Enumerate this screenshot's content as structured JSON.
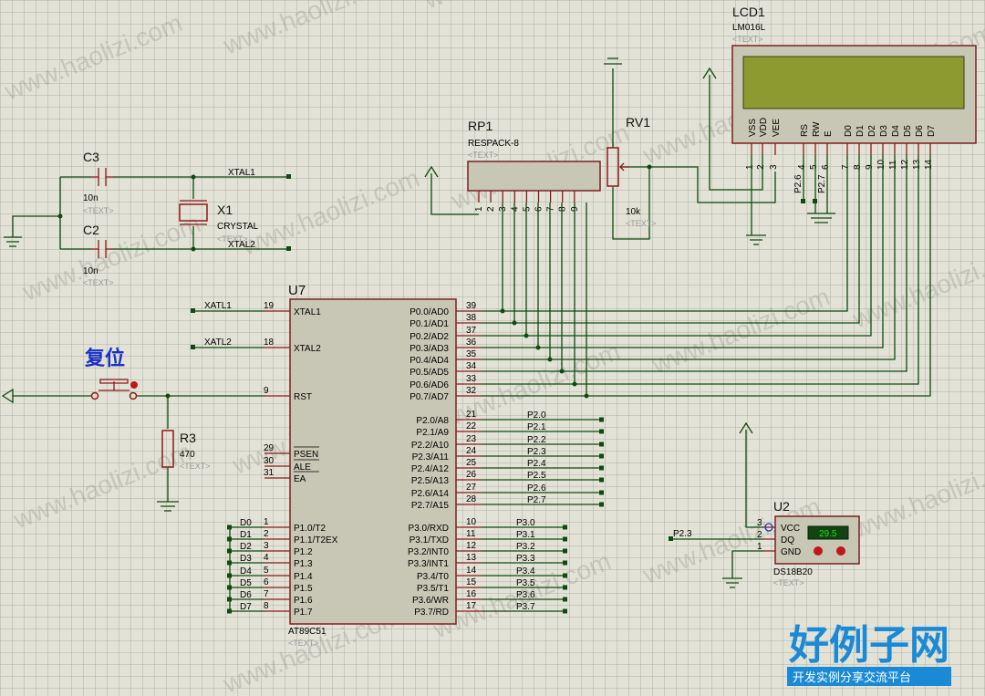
{
  "labels": {
    "c3": "C3",
    "c3_val": "10n",
    "c2": "C2",
    "c2_val": "10n",
    "x1": "X1",
    "x1_val": "CRYSTAL",
    "xtal1": "XTAL1",
    "xtal2": "XTAL2",
    "atxl1": "XATL1",
    "atxl2": "XATL2",
    "rp1": "RP1",
    "rp1_val": "RESPACK-8",
    "rv1": "RV1",
    "rv1_val": "10k",
    "lcd1": "LCD1",
    "lcd1_val": "LM016L",
    "u7": "U7",
    "u7_val": "AT89C51",
    "r3": "R3",
    "r3_val": "470",
    "reset": "复位",
    "u2": "U2",
    "u2_val": "DS18B20",
    "temp": "29.5",
    "text": "<TEXT>",
    "p26": "P2.6",
    "p27": "P2.7",
    "p23": "P2.3",
    "vcc": "VCC",
    "dq": "DQ",
    "gnd": "GND",
    "watermark": "www.haolizi.com",
    "logo_big": "好例子网",
    "logo_small": "开发实例分享交流平台"
  },
  "u7_left_pins": [
    {
      "num": "19",
      "name": "XTAL1"
    },
    {
      "num": "18",
      "name": "XTAL2"
    },
    {
      "num": "9",
      "name": "RST"
    },
    {
      "num": "29",
      "name": "PSEN"
    },
    {
      "num": "30",
      "name": "ALE"
    },
    {
      "num": "31",
      "name": "EA"
    },
    {
      "num": "1",
      "name": "P1.0/T2"
    },
    {
      "num": "2",
      "name": "P1.1/T2EX"
    },
    {
      "num": "3",
      "name": "P1.2"
    },
    {
      "num": "4",
      "name": "P1.3"
    },
    {
      "num": "5",
      "name": "P1.4"
    },
    {
      "num": "6",
      "name": "P1.5"
    },
    {
      "num": "7",
      "name": "P1.6"
    },
    {
      "num": "8",
      "name": "P1.7"
    }
  ],
  "p1_nets": [
    "D0",
    "D1",
    "D2",
    "D3",
    "D4",
    "D5",
    "D6",
    "D7"
  ],
  "p0_pins": [
    {
      "num": "39",
      "name": "P0.0/AD0"
    },
    {
      "num": "38",
      "name": "P0.1/AD1"
    },
    {
      "num": "37",
      "name": "P0.2/AD2"
    },
    {
      "num": "36",
      "name": "P0.3/AD3"
    },
    {
      "num": "35",
      "name": "P0.4/AD4"
    },
    {
      "num": "34",
      "name": "P0.5/AD5"
    },
    {
      "num": "33",
      "name": "P0.6/AD6"
    },
    {
      "num": "32",
      "name": "P0.7/AD7"
    }
  ],
  "p2_pins": [
    {
      "num": "21",
      "name": "P2.0/A8",
      "net": "P2.0"
    },
    {
      "num": "22",
      "name": "P2.1/A9",
      "net": "P2.1"
    },
    {
      "num": "23",
      "name": "P2.2/A10",
      "net": "P2.2"
    },
    {
      "num": "24",
      "name": "P2.3/A11",
      "net": "P2.3"
    },
    {
      "num": "25",
      "name": "P2.4/A12",
      "net": "P2.4"
    },
    {
      "num": "26",
      "name": "P2.5/A13",
      "net": "P2.5"
    },
    {
      "num": "27",
      "name": "P2.6/A14",
      "net": "P2.6"
    },
    {
      "num": "28",
      "name": "P2.7/A15",
      "net": "P2.7"
    }
  ],
  "p3_pins": [
    {
      "num": "10",
      "name": "P3.0/RXD",
      "net": "P3.0"
    },
    {
      "num": "11",
      "name": "P3.1/TXD",
      "net": "P3.1"
    },
    {
      "num": "12",
      "name": "P3.2/INT0",
      "net": "P3.2"
    },
    {
      "num": "13",
      "name": "P3.3/INT1",
      "net": "P3.3"
    },
    {
      "num": "14",
      "name": "P3.4/T0",
      "net": "P3.4"
    },
    {
      "num": "15",
      "name": "P3.5/T1",
      "net": "P3.5"
    },
    {
      "num": "16",
      "name": "P3.6/WR",
      "net": "P3.6"
    },
    {
      "num": "17",
      "name": "P3.7/RD",
      "net": "P3.7"
    }
  ],
  "lcd_pins": [
    {
      "num": "1",
      "name": "VSS"
    },
    {
      "num": "2",
      "name": "VDD"
    },
    {
      "num": "3",
      "name": "VEE"
    },
    {
      "num": "4",
      "name": "RS"
    },
    {
      "num": "5",
      "name": "RW"
    },
    {
      "num": "6",
      "name": "E"
    },
    {
      "num": "7",
      "name": "D0"
    },
    {
      "num": "8",
      "name": "D1"
    },
    {
      "num": "9",
      "name": "D2"
    },
    {
      "num": "10",
      "name": "D3"
    },
    {
      "num": "11",
      "name": "D4"
    },
    {
      "num": "12",
      "name": "D5"
    },
    {
      "num": "13",
      "name": "D6"
    },
    {
      "num": "14",
      "name": "D7"
    }
  ],
  "rp1_pins": [
    "1",
    "2",
    "3",
    "4",
    "5",
    "6",
    "7",
    "8",
    "9"
  ],
  "u2_pins": [
    "3",
    "2",
    "1"
  ],
  "colors": {
    "wire": "#0f4a0f",
    "pin": "#8b1a1a",
    "body": "#c8c6b4",
    "lcd_screen": "#8c9a30",
    "label_blue": "#1a30c8",
    "temp_display": "#0a8a0a"
  }
}
